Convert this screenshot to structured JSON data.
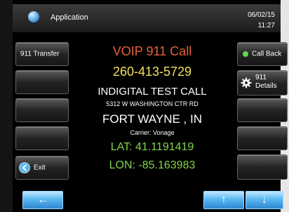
{
  "header": {
    "app_title": "Application",
    "date": "06/02/15",
    "time": "11:27",
    "app_icon": "globe-icon"
  },
  "left_buttons": {
    "transfer_label": "911 Transfer",
    "exit_label": "Exit"
  },
  "right_buttons": {
    "call_back_label": "Call Back",
    "details_label_line1": "911",
    "details_label_line2": "Details"
  },
  "call": {
    "title": "VOIP 911 Call",
    "phone": "260-413-5729",
    "caller_name": "INDIGITAL TEST CALL",
    "address": "5312 W WASHINGTON CTR RD",
    "city_state": "FORT WAYNE , IN",
    "carrier": "Carrier: Vonage",
    "lat": "LAT: 41.1191419",
    "lon": "LON: -85.163983"
  },
  "colors": {
    "title": "#e8603a",
    "phone": "#f2e35a",
    "coords": "#7fd64a",
    "status_dot": "#67d84a",
    "accent_blue": "#59b7f0"
  },
  "nav": {
    "back_icon": "left-arrow-icon",
    "up_icon": "up-arrow-icon",
    "down_icon": "down-arrow-icon"
  }
}
